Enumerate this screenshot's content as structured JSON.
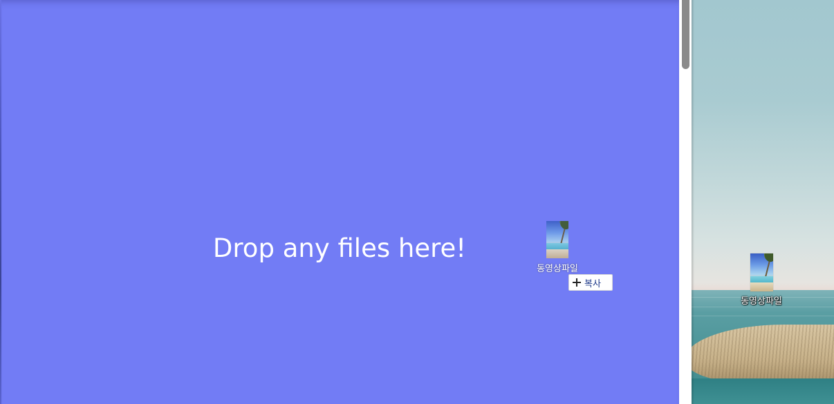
{
  "drop_zone": {
    "message": "Drop any files here!",
    "background_color": "#727cf5"
  },
  "drag_preview": {
    "file_label": "동영상파일",
    "badge": {
      "icon": "plus-icon",
      "label": "복사"
    }
  },
  "desktop": {
    "file_icon": {
      "label": "동영상파일"
    }
  }
}
